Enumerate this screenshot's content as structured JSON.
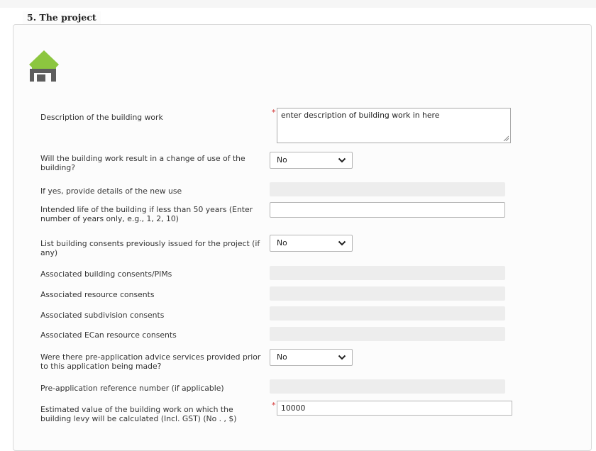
{
  "section": {
    "title": "5. The project"
  },
  "icons": {
    "house": "house-icon",
    "chevron": "chevron-down-icon",
    "resize": "resize-grip-icon"
  },
  "colors": {
    "required": "#d23030",
    "house_roof": "#8cc63f",
    "house_body": "#5d5d5d"
  },
  "fields": {
    "description": {
      "label": "Description of the building work",
      "required": "*",
      "value": "enter description of building work in here"
    },
    "change_of_use": {
      "label": "Will the building work result in a change of use of the building?",
      "selected": "No"
    },
    "new_use": {
      "label": "If yes, provide details of the new use"
    },
    "intended_life": {
      "label": "Intended life of the building if less than 50 years (Enter number of years only, e.g., 1, 2, 10)",
      "value": ""
    },
    "previous_consents": {
      "label": "List building consents previously issued for the project (if any)",
      "selected": "No"
    },
    "assoc_building": {
      "label": "Associated building consents/PIMs"
    },
    "assoc_resource": {
      "label": "Associated resource consents"
    },
    "assoc_subdivision": {
      "label": "Associated subdivision consents"
    },
    "assoc_ecan": {
      "label": "Associated ECan resource consents"
    },
    "pre_app_advice": {
      "label": "Were there pre-application advice services provided prior to this application being made?",
      "selected": "No"
    },
    "pre_app_ref": {
      "label": "Pre-application reference number (if applicable)"
    },
    "estimated_value": {
      "label": "Estimated value of the building work on which the building levy will be calculated (Incl. GST) (No . , $)",
      "required": "*",
      "value": "10000"
    }
  }
}
